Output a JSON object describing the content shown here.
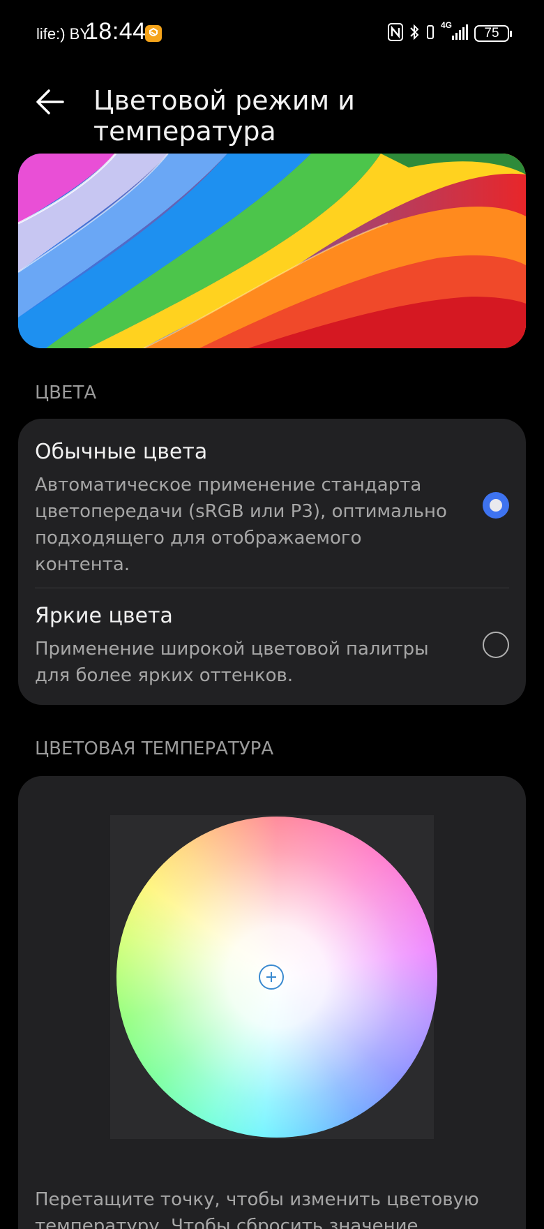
{
  "status_bar": {
    "carrier": "life:) BY",
    "time": "18:44",
    "network": "4G",
    "battery": "75"
  },
  "header": {
    "title": "Цветовой режим и температура"
  },
  "colors_section": {
    "label": "ЦВЕТА",
    "options": [
      {
        "title": "Обычные цвета",
        "description": "Автоматическое применение стандарта цветопередачи (sRGB или P3), оптимально подходящего для отображаемого контента.",
        "selected": true
      },
      {
        "title": "Яркие цвета",
        "description": "Применение широкой цветовой палитры для более ярких оттенков.",
        "selected": false
      }
    ]
  },
  "temperature_section": {
    "label": "ЦВЕТОВАЯ ТЕМПЕРАТУРА",
    "hint": "Перетащите точку, чтобы изменить цветовую температуру. Чтобы сбросить значение,"
  },
  "accent_color": "#3e73f0"
}
